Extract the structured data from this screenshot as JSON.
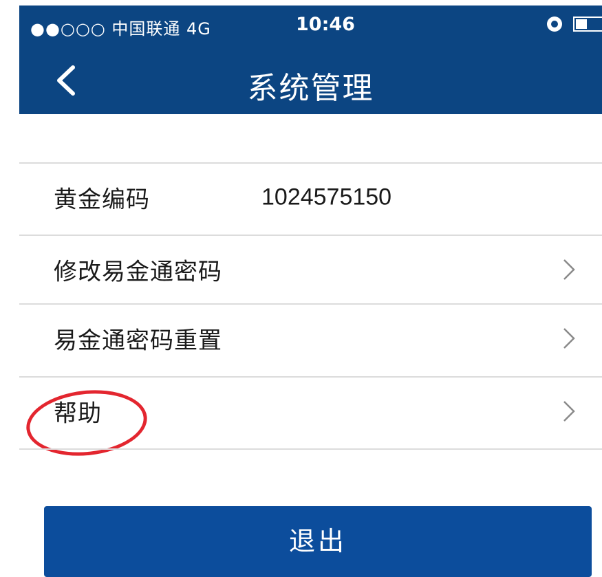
{
  "status_bar": {
    "carrier": "●●○○○ 中国联通   4G",
    "time": "10:46"
  },
  "nav": {
    "title": "系统管理"
  },
  "rows": [
    {
      "label": "黄金编码",
      "value": "1024575150"
    },
    {
      "label": "修改易金通密码"
    },
    {
      "label": "易金通密码重置"
    },
    {
      "label": "帮助"
    }
  ],
  "logout_button": "退出",
  "colors": {
    "nav_bg": "#0c4582",
    "button_bg": "#0c4d9c",
    "annotation_red": "#e3262f"
  }
}
